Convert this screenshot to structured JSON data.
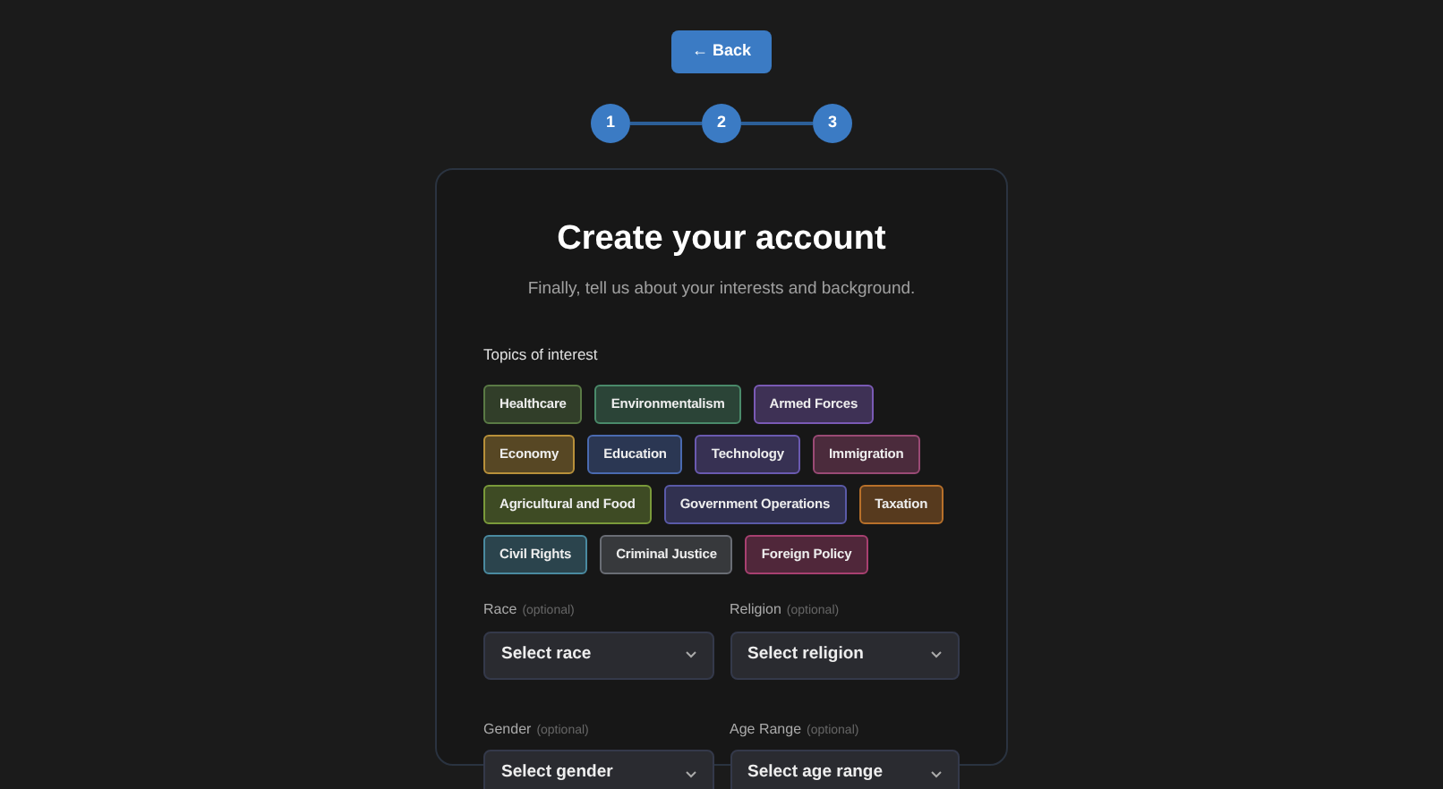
{
  "back_button": {
    "label": "← Back"
  },
  "steps": [
    {
      "label": "1"
    },
    {
      "label": "2"
    },
    {
      "label": "3"
    }
  ],
  "card": {
    "title": "Create your account",
    "subtitle": "Finally, tell us about your interests and background."
  },
  "topics": {
    "label": "Topics of interest",
    "tags": [
      {
        "label": "Healthcare",
        "color": "#5a7a45"
      },
      {
        "label": "Environmentalism",
        "color": "#4a8a6a"
      },
      {
        "label": "Armed Forces",
        "color": "#7a5ab5"
      },
      {
        "label": "Economy",
        "color": "#b8903a"
      },
      {
        "label": "Education",
        "color": "#4a6ab0"
      },
      {
        "label": "Technology",
        "color": "#6a5ab0"
      },
      {
        "label": "Immigration",
        "color": "#9a4a75"
      },
      {
        "label": "Agricultural and Food",
        "color": "#7a9a3a"
      },
      {
        "label": "Government Operations",
        "color": "#5a5aa8"
      },
      {
        "label": "Taxation",
        "color": "#b8702a"
      },
      {
        "label": "Civil Rights",
        "color": "#4a8aa0"
      },
      {
        "label": "Criminal Justice",
        "color": "#6a6d75"
      },
      {
        "label": "Foreign Policy",
        "color": "#a84070"
      }
    ]
  },
  "fields": [
    {
      "label": "Race",
      "hint": "(optional)",
      "value": "Select race"
    },
    {
      "label": "Religion",
      "hint": "(optional)",
      "value": "Select religion"
    },
    {
      "label": "Gender",
      "hint": "(optional)",
      "value": "Select gender"
    },
    {
      "label": "Age Range",
      "hint": "(optional)",
      "value": "Select age range"
    }
  ]
}
